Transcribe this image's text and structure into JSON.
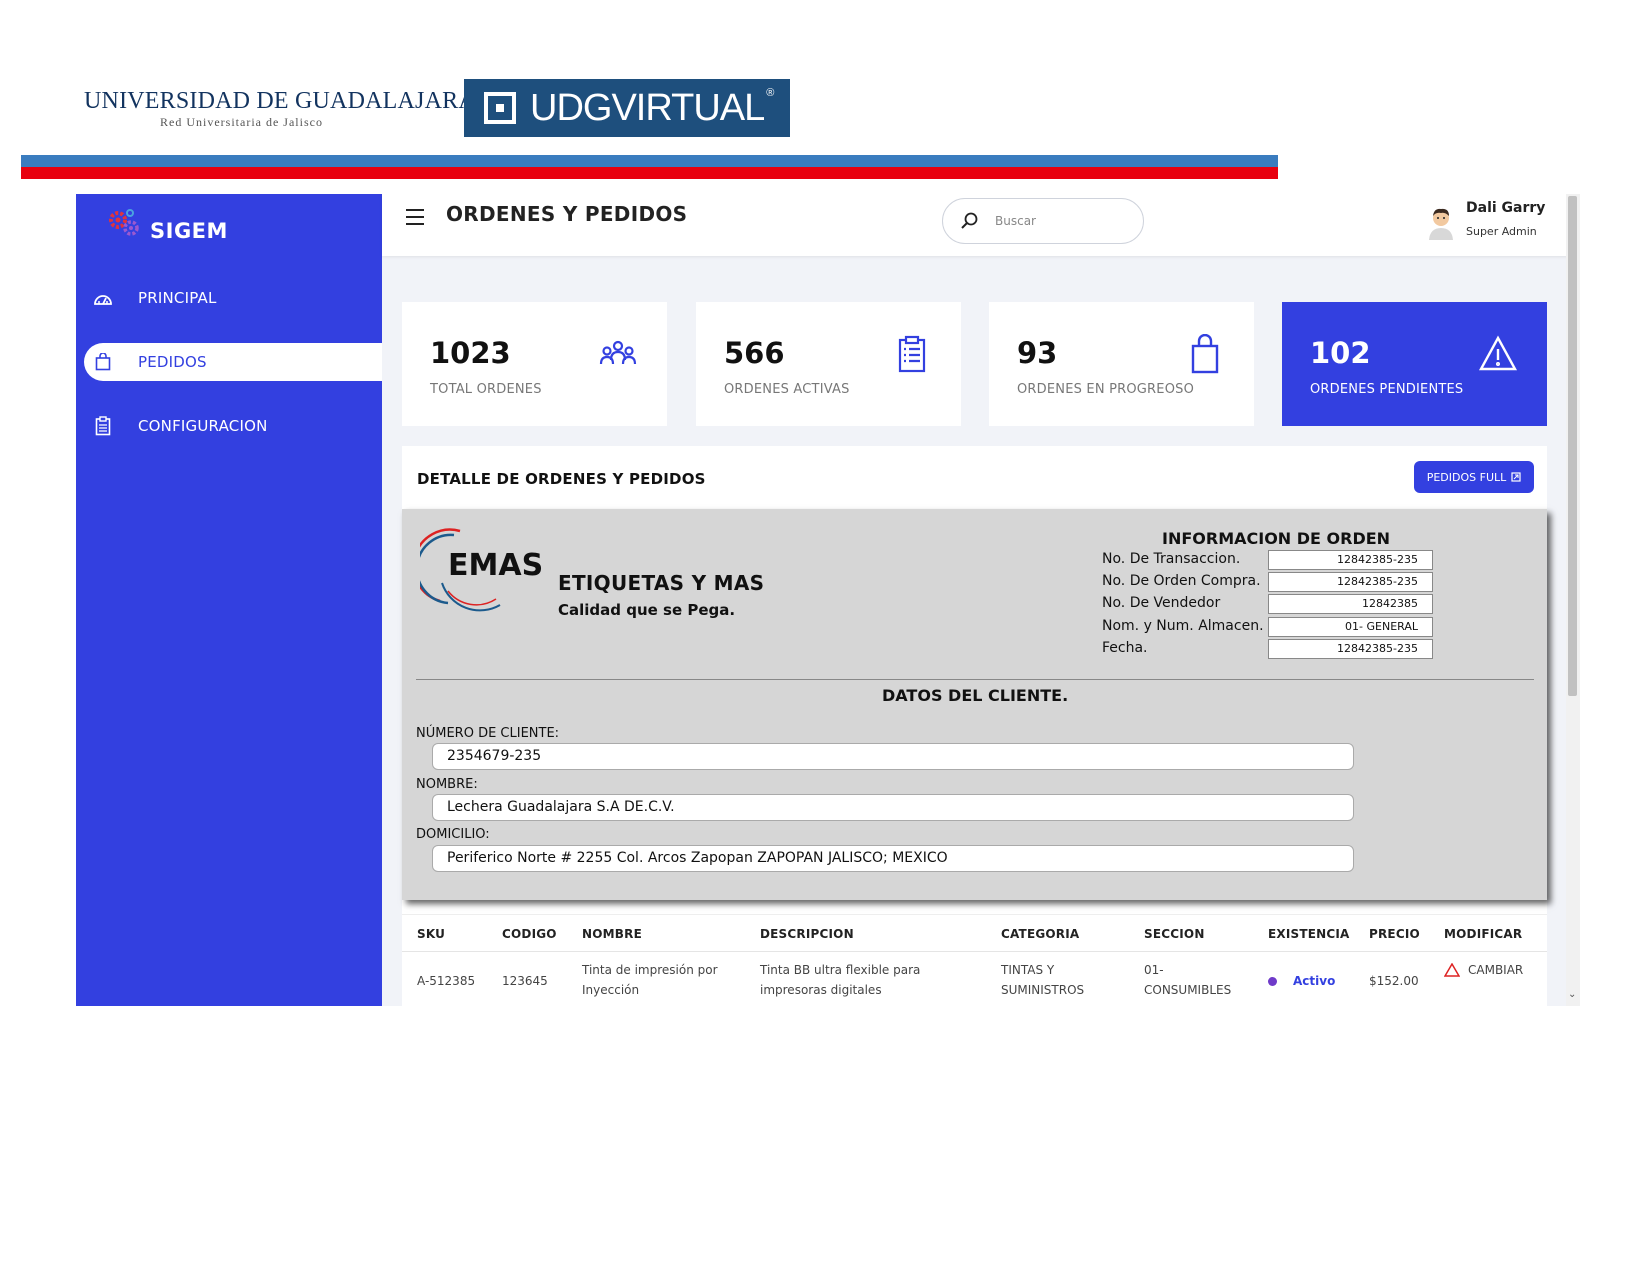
{
  "letterhead": {
    "udg_name": "UNIVERSIDAD DE GUADALAJARA",
    "udg_sub": "Red Universitaria de Jalisco",
    "udg_virtual": "UDGVIRTUAL",
    "udg_virtual_mark": "®",
    "stripe_colors": [
      "#3a7cbf",
      "#e8000f"
    ]
  },
  "sidebar": {
    "brand": "SIGEM",
    "color": "#3340e0",
    "items": [
      {
        "label": "PRINCIPAL",
        "icon": "dashboard-icon",
        "active": false
      },
      {
        "label": "PEDIDOS",
        "icon": "shopping-bag-icon",
        "active": true
      },
      {
        "label": "CONFIGURACION",
        "icon": "clipboard-icon",
        "active": false
      }
    ]
  },
  "topbar": {
    "title": "ORDENES Y PEDIDOS",
    "search_placeholder": "Buscar",
    "user_name": "Dali Garry",
    "user_role": "Super Admin"
  },
  "stats": [
    {
      "value": "1023",
      "label": "TOTAL ORDENES",
      "icon": "users-group-icon"
    },
    {
      "value": "566",
      "label": "ORDENES ACTIVAS",
      "icon": "clipboard-list-icon"
    },
    {
      "value": "93",
      "label": "ORDENES EN PROGREOSO",
      "icon": "shopping-bag-icon"
    },
    {
      "value": "102",
      "label": "ORDENES PENDIENTES",
      "icon": "warning-icon",
      "highlight": true
    }
  ],
  "detail": {
    "title": "DETALLE DE ORDENES Y PEDIDOS",
    "button": "PEDIDOS FULL",
    "button_icon": "export-icon"
  },
  "invoice": {
    "logo_text": "EMAS",
    "company": "ETIQUETAS Y MAS",
    "slogan": "Calidad que se Pega.",
    "info_title": "INFORMACION DE ORDEN",
    "info_rows": [
      {
        "label": "No. De Transaccion.",
        "value": "12842385-235"
      },
      {
        "label": "No. De Orden Compra.",
        "value": "12842385-235"
      },
      {
        "label": "No. De Vendedor",
        "value": "12842385"
      },
      {
        "label": "Nom. y Num. Almacen.",
        "value": "01- GENERAL"
      },
      {
        "label": "Fecha.",
        "value": "12842385-235"
      }
    ],
    "cliente_title": "DATOS DEL CLIENTE.",
    "cliente": {
      "numero_label": "NÚMERO DE CLIENTE:",
      "numero": "2354679-235",
      "nombre_label": "NOMBRE:",
      "nombre": "Lechera Guadalajara S.A DE.C.V.",
      "domicilio_label": "DOMICILIO:",
      "domicilio": "Periferico Norte # 2255 Col. Arcos Zapopan ZAPOPAN JALISCO; MEXICO"
    }
  },
  "table": {
    "headers": [
      "SKU",
      "CODIGO",
      "NOMBRE",
      "DESCRIPCION",
      "CATEGORIA",
      "SECCION",
      "EXISTENCIA",
      "PRECIO",
      "MODIFICAR"
    ],
    "rows": [
      {
        "sku": "A-512385",
        "codigo": "123645",
        "nombre": "Tinta de impresión por Inyección",
        "descripcion": "Tinta BB ultra flexible para impresoras digitales",
        "categoria": "TINTAS Y SUMINISTROS",
        "seccion": "01- CONSUMIBLES",
        "existencia": "Activo",
        "precio": "$152.00",
        "modificar": "CAMBIAR"
      }
    ]
  }
}
